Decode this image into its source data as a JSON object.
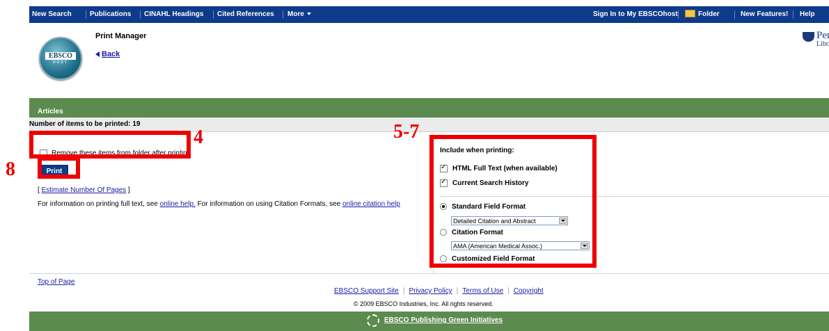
{
  "top_nav": {
    "left": [
      "New Search",
      "Publications",
      "CINAHL Headings",
      "Cited References",
      "More"
    ],
    "right": [
      "Sign In to My EBSCOhost",
      "Folder",
      "New Features!",
      "Help"
    ]
  },
  "header": {
    "title": "Print Manager",
    "back": "Back",
    "logo": {
      "line1": "EBSCO",
      "line2": "HOST"
    },
    "library": {
      "name": "Penn",
      "sub": "Library"
    }
  },
  "section": "Articles",
  "items_count_text": "Number of items to be printed: 19",
  "left": {
    "remove_checkbox": {
      "label": "Remove these items from folder after printing",
      "checked": false
    },
    "print_button": "Print",
    "estimate": {
      "prefix": "[ ",
      "link": "Estimate Number Of Pages",
      "suffix": " ]"
    },
    "info": {
      "text1": "For information on printing full text, see ",
      "link1": "online help.",
      "text2": " For information on using Citation Formats, see ",
      "link2": "online citation help"
    }
  },
  "right": {
    "heading": "Include when printing:",
    "options": [
      {
        "label": "HTML Full Text (when available)",
        "checked": true
      },
      {
        "label": "Current Search History",
        "checked": true
      }
    ],
    "formats": [
      {
        "label": "Standard Field Format",
        "selected": true,
        "dropdown": "Detailed Citation and Abstract"
      },
      {
        "label": "Citation Format",
        "selected": false,
        "dropdown": "AMA (American Medical Assoc.)"
      },
      {
        "label": "Customized Field Format",
        "selected": false
      }
    ]
  },
  "footer": {
    "top_of_page": "Top of Page",
    "links": [
      "EBSCO Support Site",
      "Privacy Policy",
      "Terms of Use",
      "Copyright"
    ],
    "copyright": "© 2009 EBSCO Industries, Inc. All rights reserved.",
    "green_initiatives": "EBSCO Publishing Green Initiatives"
  },
  "annotations": {
    "a4": "4",
    "a57": "5-7",
    "a8": "8",
    "color": "#ee0000"
  },
  "colors": {
    "nav": "#0e3a8a",
    "green": "#5c8b4f",
    "link": "#1a1aa6",
    "annotation": "#ee0000"
  }
}
